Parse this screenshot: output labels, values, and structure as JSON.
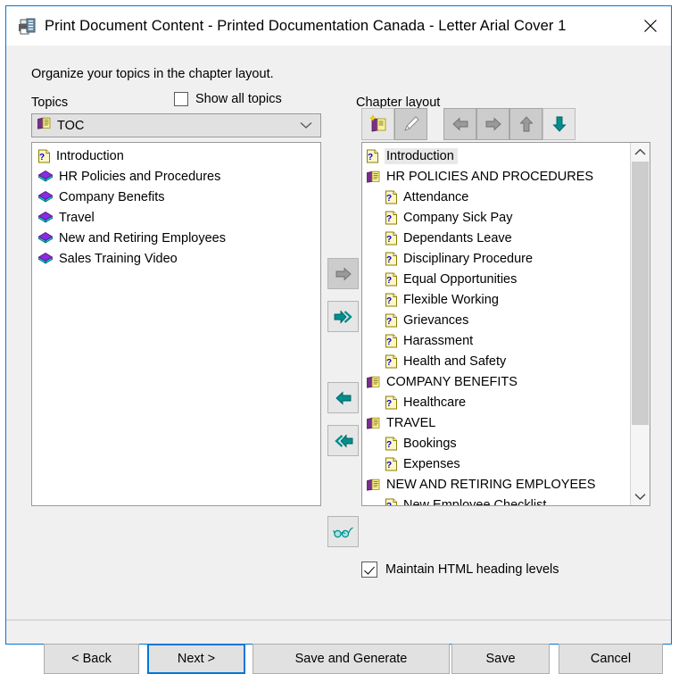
{
  "window": {
    "title": "Print Document Content - Printed Documentation Canada - Letter Arial Cover 1",
    "title_icon": "printer-icon",
    "close_icon": "close-icon"
  },
  "instruction": "Organize your topics in the chapter layout.",
  "left_panel": {
    "label": "Topics",
    "show_all": {
      "label": "Show all topics",
      "checked": false
    },
    "dropdown": {
      "value": "TOC",
      "icon": "open-book-icon",
      "chevron": "chevron-down-icon"
    },
    "items": [
      {
        "label": "Introduction",
        "icon": "help-topic-icon"
      },
      {
        "label": "HR Policies and Procedures",
        "icon": "book-icon"
      },
      {
        "label": "Company Benefits",
        "icon": "book-icon"
      },
      {
        "label": "Travel",
        "icon": "book-icon"
      },
      {
        "label": "New and Retiring Employees",
        "icon": "book-icon"
      },
      {
        "label": "Sales Training Video",
        "icon": "book-icon"
      }
    ]
  },
  "transfer_buttons": [
    {
      "name": "move-right-single",
      "icon": "arrow-right-icon",
      "enabled": false
    },
    {
      "name": "move-right-all",
      "icon": "arrow-double-right-icon",
      "enabled": true
    },
    {
      "name": "move-left-single",
      "icon": "arrow-left-icon",
      "enabled": true
    },
    {
      "name": "move-left-all",
      "icon": "arrow-double-left-icon",
      "enabled": true
    },
    {
      "name": "preview",
      "icon": "glasses-icon",
      "enabled": true
    }
  ],
  "right_panel": {
    "label": "Chapter layout",
    "toolbar": [
      {
        "name": "new-chapter",
        "icon": "new-book-icon",
        "enabled": true
      },
      {
        "name": "rename-chapter",
        "icon": "pencil-icon",
        "enabled": false
      },
      {
        "name": "outdent",
        "icon": "arrow-left-icon",
        "enabled": false
      },
      {
        "name": "indent",
        "icon": "arrow-right-icon",
        "enabled": false
      },
      {
        "name": "move-up",
        "icon": "arrow-up-icon",
        "enabled": false
      },
      {
        "name": "move-down",
        "icon": "arrow-down-icon",
        "enabled": true
      }
    ],
    "items": [
      {
        "label": "Introduction",
        "icon": "help-topic-icon",
        "level": 0,
        "selected": true
      },
      {
        "label": "HR POLICIES AND PROCEDURES",
        "icon": "open-book-icon",
        "level": 0,
        "selected": false
      },
      {
        "label": "Attendance",
        "icon": "help-topic-icon",
        "level": 1,
        "selected": false
      },
      {
        "label": "Company Sick Pay",
        "icon": "help-topic-icon",
        "level": 1,
        "selected": false
      },
      {
        "label": "Dependants Leave",
        "icon": "help-topic-icon",
        "level": 1,
        "selected": false
      },
      {
        "label": "Disciplinary Procedure",
        "icon": "help-topic-icon",
        "level": 1,
        "selected": false
      },
      {
        "label": "Equal Opportunities",
        "icon": "help-topic-icon",
        "level": 1,
        "selected": false
      },
      {
        "label": "Flexible Working",
        "icon": "help-topic-icon",
        "level": 1,
        "selected": false
      },
      {
        "label": "Grievances",
        "icon": "help-topic-icon",
        "level": 1,
        "selected": false
      },
      {
        "label": "Harassment",
        "icon": "help-topic-icon",
        "level": 1,
        "selected": false
      },
      {
        "label": "Health and Safety",
        "icon": "help-topic-icon",
        "level": 1,
        "selected": false
      },
      {
        "label": "COMPANY BENEFITS",
        "icon": "open-book-icon",
        "level": 0,
        "selected": false
      },
      {
        "label": "Healthcare",
        "icon": "help-topic-icon",
        "level": 1,
        "selected": false
      },
      {
        "label": "TRAVEL",
        "icon": "open-book-icon",
        "level": 0,
        "selected": false
      },
      {
        "label": "Bookings",
        "icon": "help-topic-icon",
        "level": 1,
        "selected": false
      },
      {
        "label": "Expenses",
        "icon": "help-topic-icon",
        "level": 1,
        "selected": false
      },
      {
        "label": "NEW AND RETIRING EMPLOYEES",
        "icon": "open-book-icon",
        "level": 0,
        "selected": false
      },
      {
        "label": "New Employee Checklist",
        "icon": "help-topic-icon",
        "level": 1,
        "selected": false
      }
    ],
    "scrollbar": {
      "up_icon": "chevron-up-icon",
      "down_icon": "chevron-down-icon"
    },
    "maintain": {
      "label": "Maintain HTML heading levels",
      "checked": true
    }
  },
  "footer": {
    "back": "< Back",
    "next": "Next >",
    "save_and_generate": "Save and Generate",
    "save": "Save",
    "cancel": "Cancel"
  },
  "colors": {
    "accent": "#0078d7",
    "dialog_bg": "#f0f0f0",
    "teal_icon": "#008080",
    "disabled_icon": "#808080",
    "book_purple": "#800080",
    "book_cyan": "#00ffff"
  }
}
